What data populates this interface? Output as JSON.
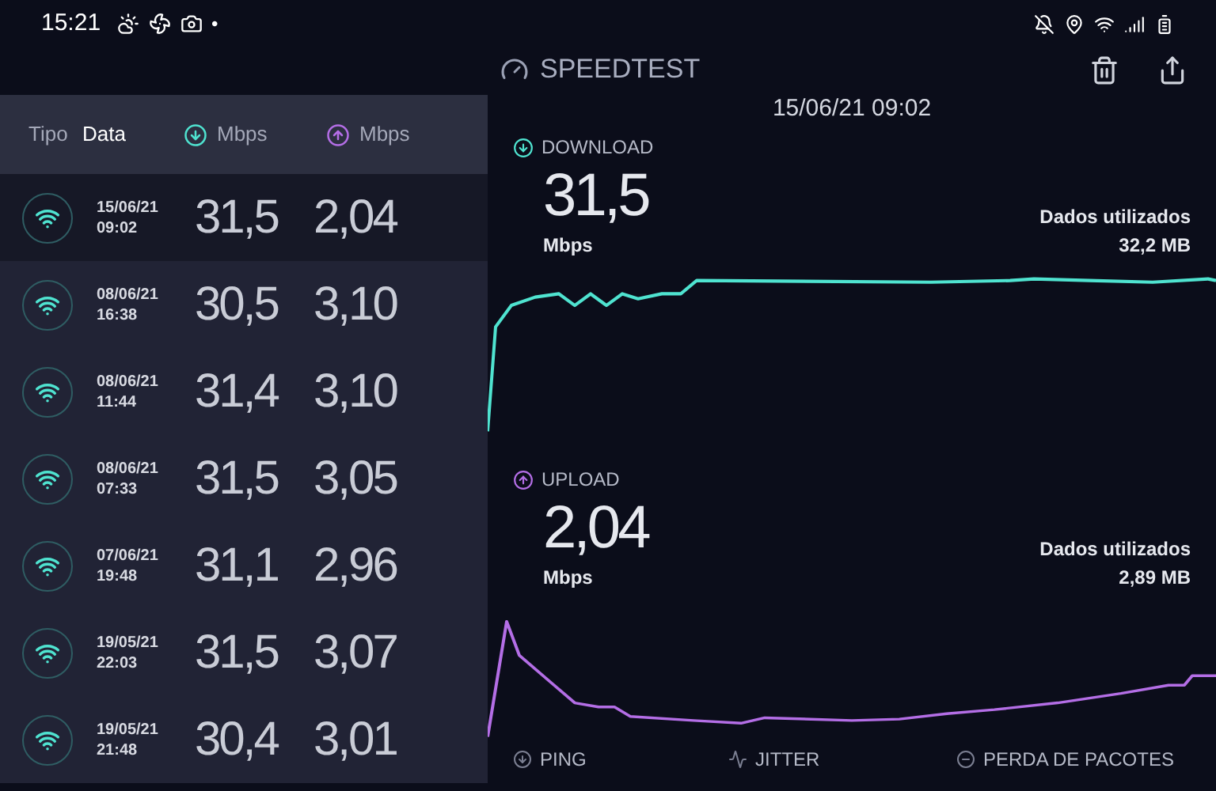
{
  "status_bar": {
    "time": "15:21",
    "notification_dot": "•"
  },
  "history": {
    "columns": [
      {
        "kind": "text",
        "label": "Tipo",
        "selected": false
      },
      {
        "kind": "text",
        "label": "Data",
        "selected": true
      },
      {
        "kind": "download",
        "label": "Mbps",
        "selected": false
      },
      {
        "kind": "upload",
        "label": "Mbps",
        "selected": false
      }
    ],
    "rows": [
      {
        "date": "15/06/21",
        "time": "09:02",
        "download": "31,5",
        "upload": "2,04",
        "selected": true
      },
      {
        "date": "08/06/21",
        "time": "16:38",
        "download": "30,5",
        "upload": "3,10",
        "selected": false
      },
      {
        "date": "08/06/21",
        "time": "11:44",
        "download": "31,4",
        "upload": "3,10",
        "selected": false
      },
      {
        "date": "08/06/21",
        "time": "07:33",
        "download": "31,5",
        "upload": "3,05",
        "selected": false
      },
      {
        "date": "07/06/21",
        "time": "19:48",
        "download": "31,1",
        "upload": "2,96",
        "selected": false
      },
      {
        "date": "19/05/21",
        "time": "22:03",
        "download": "31,5",
        "upload": "3,07",
        "selected": false
      },
      {
        "date": "19/05/21",
        "time": "21:48",
        "download": "30,4",
        "upload": "3,01",
        "selected": false
      }
    ]
  },
  "detail": {
    "title": "SPEEDTEST",
    "datetime": "15/06/21 09:02",
    "sections": [
      {
        "kind": "download",
        "label": "DOWNLOAD",
        "value": "31,5",
        "unit": "Mbps",
        "data_label": "Dados utilizados",
        "data_value": "32,2 MB"
      },
      {
        "kind": "upload",
        "label": "UPLOAD",
        "value": "2,04",
        "unit": "Mbps",
        "data_label": "Dados utilizados",
        "data_value": "2,89 MB"
      }
    ],
    "metrics": [
      {
        "kind": "ping",
        "label": "PING"
      },
      {
        "kind": "jitter",
        "label": "JITTER"
      },
      {
        "kind": "loss",
        "label": "PERDA DE PACOTES"
      }
    ]
  }
}
